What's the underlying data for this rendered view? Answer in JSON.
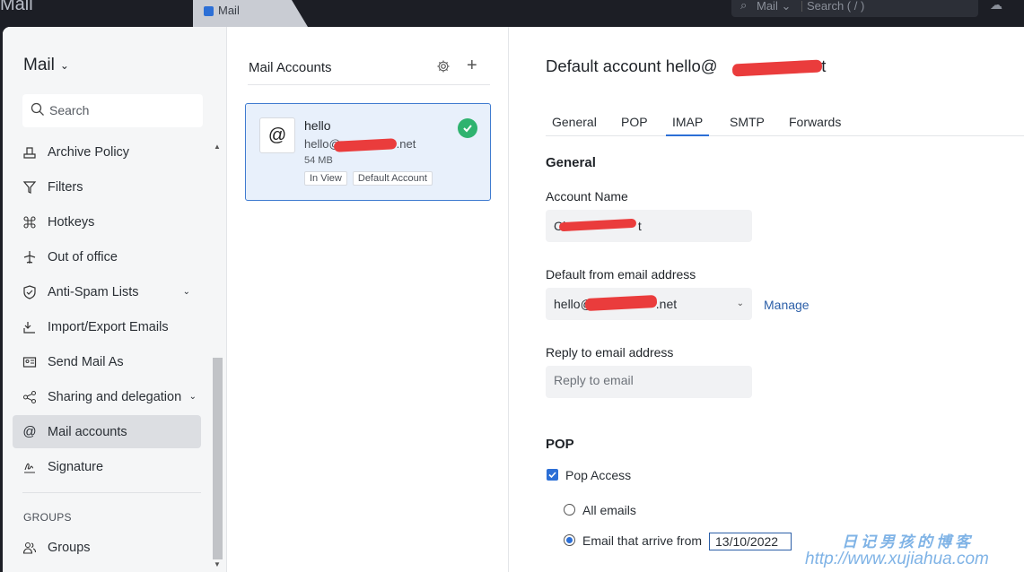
{
  "topbar": {
    "app_name": "Mail",
    "tab_label": "Mail",
    "search_module": "Mail",
    "search_placeholder": "Search ( / )"
  },
  "sidebar": {
    "title": "Mail",
    "search_placeholder": "Search",
    "items": [
      {
        "label": "Archive Policy",
        "icon": "archive-icon"
      },
      {
        "label": "Filters",
        "icon": "filter-icon"
      },
      {
        "label": "Hotkeys",
        "icon": "command-icon"
      },
      {
        "label": "Out of office",
        "icon": "airplane-icon"
      },
      {
        "label": "Anti-Spam Lists",
        "icon": "shield-icon"
      },
      {
        "label": "Import/Export Emails",
        "icon": "import-export-icon"
      },
      {
        "label": "Send Mail As",
        "icon": "send-as-icon"
      },
      {
        "label": "Sharing and delegation",
        "icon": "share-icon"
      },
      {
        "label": "Mail accounts",
        "icon": "at-icon"
      },
      {
        "label": "Signature",
        "icon": "signature-icon"
      }
    ],
    "groups_heading": "GROUPS",
    "groups_item": "Groups"
  },
  "accounts": {
    "title": "Mail Accounts",
    "card": {
      "name": "hello",
      "email_prefix": "hello@",
      "email_suffix": ".net",
      "size": "54 MB",
      "badges": [
        "In View",
        "Default Account"
      ]
    }
  },
  "content": {
    "title_prefix": "Default account hello@",
    "title_suffix": ".net",
    "tabs": [
      "General",
      "POP",
      "IMAP",
      "SMTP",
      "Forwards"
    ],
    "active_tab": "IMAP",
    "general_heading": "General",
    "account_name_label": "Account Name",
    "account_name_prefix": "Ch",
    "account_name_suffix": "t",
    "default_from_label": "Default from email address",
    "default_from_prefix": "hello@",
    "default_from_suffix": ".net",
    "manage_link": "Manage",
    "reply_to_label": "Reply to email address",
    "reply_to_placeholder": "Reply to email",
    "pop_heading": "POP",
    "pop_access_label": "Pop Access",
    "radio_all": "All emails",
    "radio_from": "Email that arrive from",
    "from_date": "13/10/2022"
  },
  "watermark": {
    "line1": "日记男孩的博客",
    "line2": "http://www.xujiahua.com"
  },
  "colors": {
    "accent": "#2c6fd6",
    "link": "#2c5fa8",
    "success": "#2fb36f",
    "redaction": "#ea3c3c"
  }
}
